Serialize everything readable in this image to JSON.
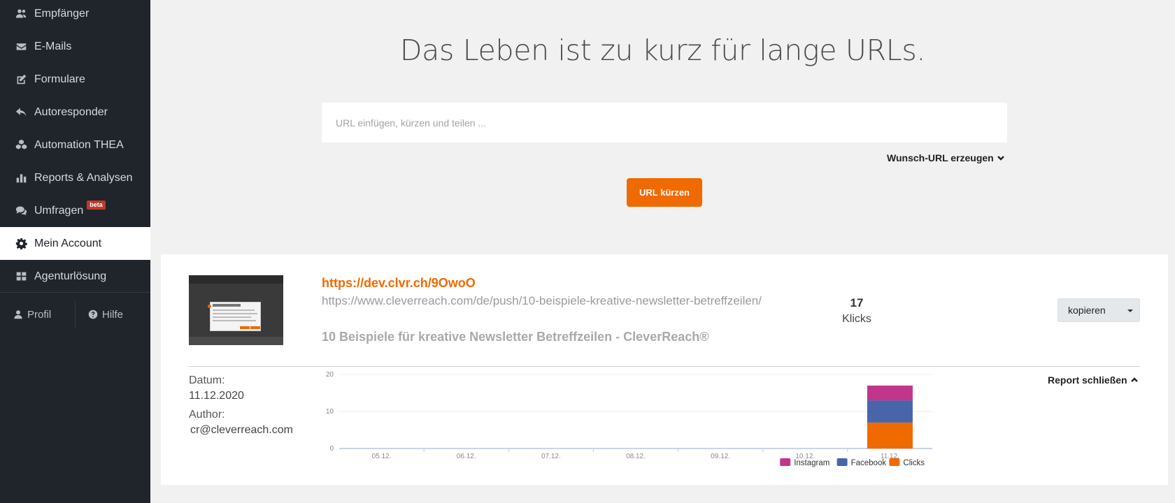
{
  "sidebar": {
    "items": [
      {
        "label": "Empfänger",
        "icon": "users-icon"
      },
      {
        "label": "E-Mails",
        "icon": "envelope-icon"
      },
      {
        "label": "Formulare",
        "icon": "edit-icon"
      },
      {
        "label": "Autoresponder",
        "icon": "reply-icon"
      },
      {
        "label": "Automation THEA",
        "icon": "cubes-icon"
      },
      {
        "label": "Reports & Analysen",
        "icon": "bar-chart-icon"
      },
      {
        "label": "Umfragen",
        "icon": "comments-icon",
        "badge": "beta"
      },
      {
        "label": "Mein Account",
        "icon": "gear-icon",
        "active": true
      },
      {
        "label": "Agenturlösung",
        "icon": "grid-icon"
      }
    ],
    "profile_label": "Profil",
    "help_label": "Hilfe"
  },
  "hero": {
    "title": "Das Leben ist zu kurz für lange URLs.",
    "input_placeholder": "URL einfügen, kürzen und teilen ...",
    "input_value": "",
    "custom_url_label": "Wunsch-URL erzeugen",
    "shorten_button": "URL kürzen"
  },
  "result": {
    "short_url": "https://dev.clvr.ch/9OwoO",
    "long_url": "https://www.cleverreach.com/de/push/10-beispiele-kreative-newsletter-betreffzeilen/",
    "page_title": "10 Beispiele für kreative Newsletter Betreffzeilen - CleverReach®",
    "clicks_count": "17",
    "clicks_label": "Klicks",
    "copy_button": "kopieren",
    "date_label": "Datum:",
    "date_value": "11.12.2020",
    "author_label": "Author:",
    "author_value": "cr@cleverreach.com",
    "report_close_label": "Report schließen"
  },
  "colors": {
    "accent": "#ef6a00",
    "sidebar_bg": "#20242b",
    "instagram": "#c1358b",
    "facebook": "#4765a8",
    "clicks": "#ef6a00"
  },
  "chart_data": {
    "type": "bar",
    "stacked": true,
    "categories": [
      "05.12.",
      "06.12.",
      "07.12.",
      "08.12.",
      "09.12.",
      "10.12.",
      "11.12."
    ],
    "series": [
      {
        "name": "Clicks",
        "color": "#ef6a00",
        "values": [
          0,
          0,
          0,
          0,
          0,
          0,
          7
        ]
      },
      {
        "name": "Facebook",
        "color": "#4765a8",
        "values": [
          0,
          0,
          0,
          0,
          0,
          0,
          6
        ]
      },
      {
        "name": "Instagram",
        "color": "#c1358b",
        "values": [
          0,
          0,
          0,
          0,
          0,
          0,
          4
        ]
      }
    ],
    "yticks": [
      "0",
      "10",
      "20"
    ],
    "ylim": [
      0,
      20
    ],
    "grid": true,
    "legend": "bottom-right",
    "legend_order": [
      "Instagram",
      "Facebook",
      "Clicks"
    ]
  }
}
